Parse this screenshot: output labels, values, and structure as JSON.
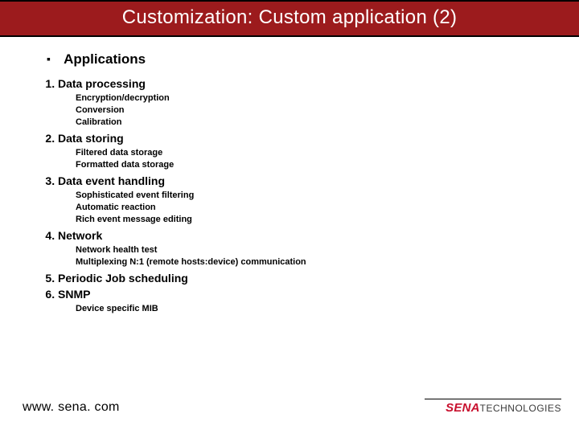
{
  "title": "Customization: Custom application (2)",
  "section": "Applications",
  "items": [
    {
      "label": "Data processing",
      "subs": [
        "Encryption/decryption",
        "Conversion",
        "Calibration"
      ]
    },
    {
      "label": "Data storing",
      "subs": [
        "Filtered data storage",
        "Formatted data storage"
      ]
    },
    {
      "label": "Data event handling",
      "subs": [
        "Sophisticated event filtering",
        "Automatic reaction",
        "Rich event message editing"
      ]
    },
    {
      "label": "Network",
      "subs": [
        "Network health test",
        "Multiplexing N:1 (remote hosts:device) communication"
      ]
    },
    {
      "label": "Periodic Job scheduling",
      "subs": []
    },
    {
      "label": "SNMP",
      "subs": [
        "Device specific MIB"
      ]
    }
  ],
  "footer_url": "www. sena. com",
  "logo": {
    "sena": "SENA",
    "tech": "TECHNOLOGIES"
  }
}
